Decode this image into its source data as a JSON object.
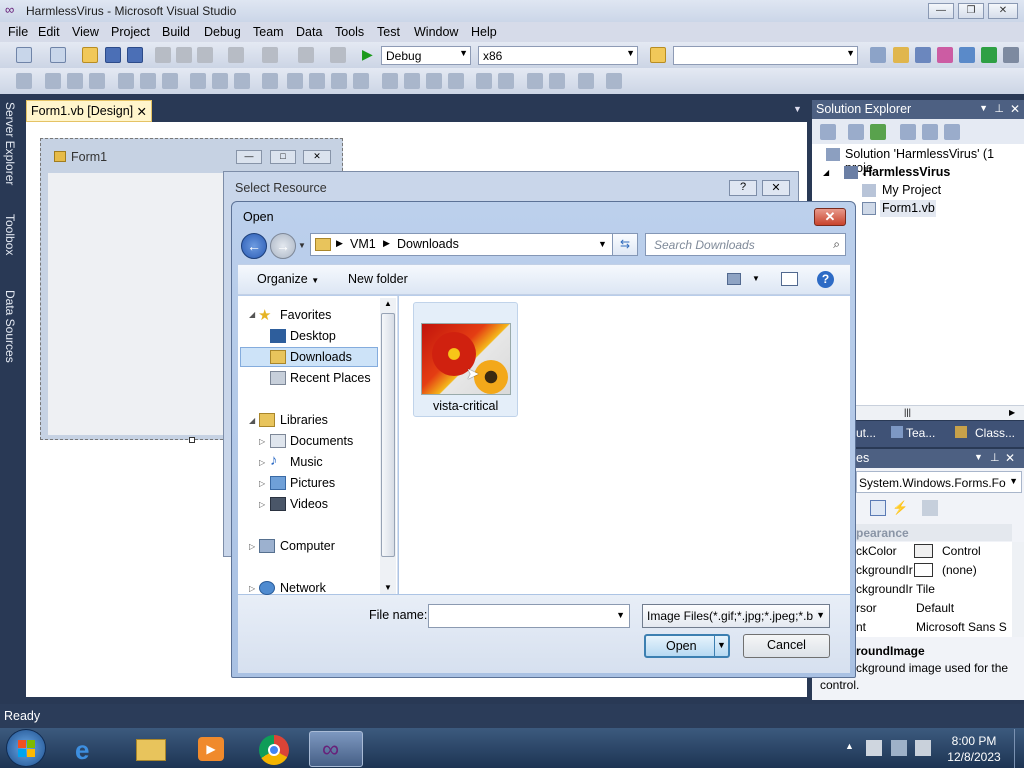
{
  "vs": {
    "title": "HarmlessVirus - Microsoft Visual Studio",
    "menu": [
      "File",
      "Edit",
      "View",
      "Project",
      "Build",
      "Debug",
      "Team",
      "Data",
      "Tools",
      "Test",
      "Window",
      "Help"
    ],
    "config_combo": "Debug",
    "platform_combo": "x86",
    "left_strip": [
      "Server Explorer",
      "Toolbox",
      "Data Sources"
    ],
    "doc_tab": "Form1.vb [Design]",
    "form_title": "Form1",
    "status": "Ready"
  },
  "select_resource": {
    "title": "Select Resource"
  },
  "solution_explorer": {
    "title": "Solution Explorer",
    "solution": "Solution 'HarmlessVirus' (1 proje",
    "project": "HarmlessVirus",
    "items": [
      "My Project",
      "Form1.vb"
    ],
    "tabs": [
      "ut...",
      "Tea...",
      "Class..."
    ]
  },
  "properties": {
    "title": "es",
    "object": "System.Windows.Forms.Fo",
    "category": "pearance",
    "rows": [
      {
        "name": "ckColor",
        "value": "Control"
      },
      {
        "name": "ckgroundIr",
        "value": "(none)"
      },
      {
        "name": "ckgroundIr",
        "value": "Tile"
      },
      {
        "name": "rsor",
        "value": "Default"
      },
      {
        "name": "nt",
        "value": "Microsoft Sans S"
      }
    ],
    "desc_title": "roundImage",
    "desc_text_1": "ckground image used for the",
    "desc_text_2": "control."
  },
  "open_dialog": {
    "title": "Open",
    "breadcrumb": [
      "VM1",
      "Downloads"
    ],
    "search_placeholder": "Search Downloads",
    "organize": "Organize",
    "new_folder": "New folder",
    "nav": {
      "favorites": "Favorites",
      "desktop": "Desktop",
      "downloads": "Downloads",
      "recent": "Recent Places",
      "libraries": "Libraries",
      "documents": "Documents",
      "music": "Music",
      "pictures": "Pictures",
      "videos": "Videos",
      "computer": "Computer",
      "network": "Network"
    },
    "file": {
      "name": "vista-critical"
    },
    "file_name_label": "File name:",
    "file_name_value": "",
    "filter": "Image Files(*.gif;*.jpg;*.jpeg;*.b",
    "open_label": "Open",
    "cancel_label": "Cancel"
  },
  "taskbar": {
    "time": "8:00 PM",
    "date": "12/8/2023"
  }
}
